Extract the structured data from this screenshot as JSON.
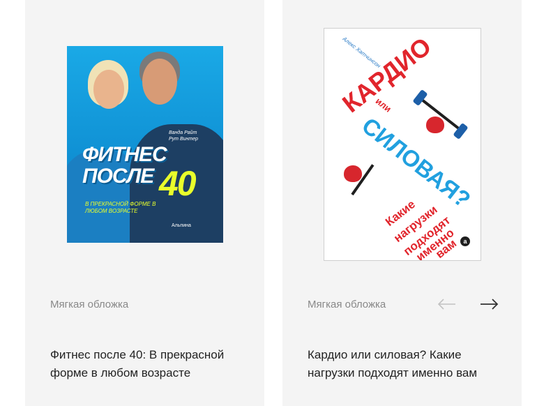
{
  "colors": {
    "card_bg": "#f4f4f4",
    "text_main": "#222222",
    "text_muted": "#888888",
    "arrow_disabled": "#c2c2c2",
    "arrow_active": "#333333"
  },
  "carousel": {
    "prev_icon": "arrow-left-icon",
    "next_icon": "arrow-right-icon"
  },
  "books": [
    {
      "cover": {
        "authors_line1": "Ванда Райт",
        "authors_line2": "Рут Винтер",
        "title_line1": "ФИТНЕС",
        "title_line2": "ПОСЛЕ",
        "title_number": "40",
        "subtitle": "В прекрасной форме в любом возрасте",
        "publisher": "Альпина"
      },
      "format": "Мягкая обложка",
      "title": "Фитнес после 40: В прекрасной форме в любом возрасте"
    },
    {
      "cover": {
        "author": "Алекс Хатчинсон",
        "title_line1": "КАРДИО",
        "title_or": "или",
        "title_line2": "СИЛОВАЯ?",
        "sub1": "Какие",
        "sub2": "нагрузки",
        "sub3": "подходят",
        "sub4": "именно",
        "sub5": "вам",
        "publisher_mark": "а"
      },
      "format": "Мягкая обложка",
      "title": "Кардио или силовая? Какие нагрузки подходят именно вам"
    }
  ]
}
